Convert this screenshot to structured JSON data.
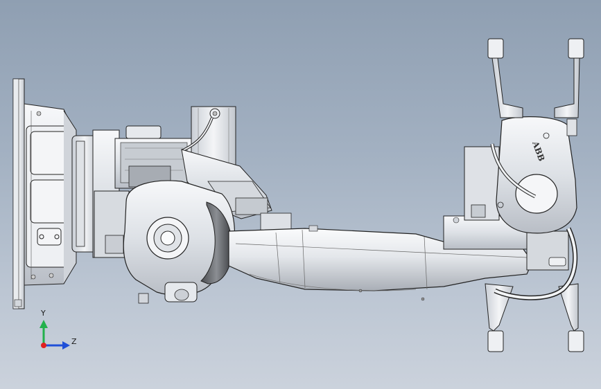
{
  "view": {
    "background_top": "#8f9fb2",
    "background_bottom": "#cbd2dc",
    "part_fill": "#eef0f3",
    "part_stroke": "#2a2a2a"
  },
  "model": {
    "brand_label": "ABB"
  },
  "triad": {
    "y_label": "Y",
    "z_label": "Z",
    "y_color": "#22b14c",
    "z_color": "#1f4fd8",
    "x_color": "#e02020"
  }
}
